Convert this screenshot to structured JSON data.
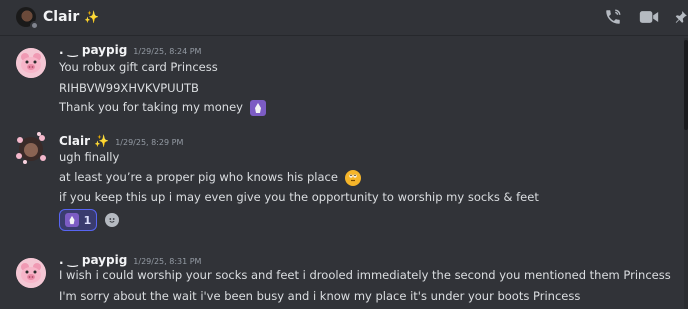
{
  "header": {
    "channel_name": "Clair",
    "icons": [
      "voice-call-icon",
      "video-call-icon",
      "pin-icon"
    ]
  },
  "messages": [
    {
      "author": ". ‿ paypig",
      "timestamp": "1/29/25, 8:24 PM",
      "lines": [
        "You robux gift card Princess",
        "RIHBVW99XHVKVPUUTB",
        "Thank you for taking my money"
      ]
    },
    {
      "author": "Clair",
      "timestamp": "1/29/25, 8:29 PM",
      "lines": [
        "ugh finally",
        "at least you’re a proper pig who knows his place",
        "if you keep this up i may even give you the opportunity to worship my socks & feet"
      ],
      "reaction_count": "1"
    },
    {
      "author": ". ‿ paypig",
      "timestamp": "1/29/25, 8:31 PM",
      "lines": [
        "I wish i could worship your socks and feet i drooled immediately the second you mentioned them Princess",
        "I'm sorry about the wait i've been busy and i know my place it's under your boots Princess"
      ]
    }
  ],
  "colors": {
    "background": "#313338",
    "accent": "#5865f2",
    "text": "#dbdee1"
  }
}
